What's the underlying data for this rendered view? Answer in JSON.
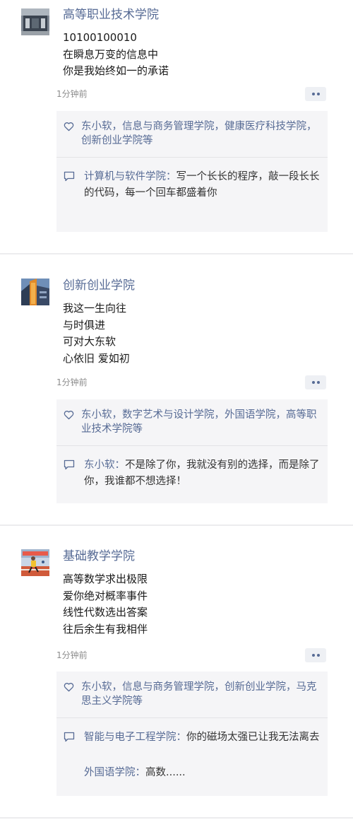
{
  "posts": [
    {
      "author": "高等职业技术学院",
      "lines": [
        "10100100010",
        "在瞬息万变的信息中",
        "你是我始终如一的承诺"
      ],
      "time": "1分钟前",
      "likes": "东小软，信息与商务管理学院，健康医疗科技学院，创新创业学院等",
      "comments": [
        {
          "name": "计算机与软件学院",
          "sep": "：",
          "text": "写一个长长的程序，敲一段长长的代码，每一个回车都盛着你"
        }
      ]
    },
    {
      "author": "创新创业学院",
      "lines": [
        "我这一生向往",
        "与时俱进",
        "可对大东软",
        "心依旧 爱如初"
      ],
      "time": "1分钟前",
      "likes": "东小软，数字艺术与设计学院，外国语学院，高等职业技术学院等",
      "comments": [
        {
          "name": "东小软",
          "sep": "：",
          "text": "不是除了你，我就没有别的选择，而是除了你，我谁都不想选择！"
        }
      ]
    },
    {
      "author": "基础教学学院",
      "lines": [
        "高等数学求出极限",
        "爱你绝对概率事件",
        "线性代数选出答案",
        "往后余生有我相伴"
      ],
      "time": "1分钟前",
      "likes": "东小软，信息与商务管理学院，创新创业学院，马克思主义学院等",
      "comments": [
        {
          "name": "智能与电子工程学院",
          "sep": "：",
          "text": "你的磁场太强已让我无法离去"
        },
        {
          "name": "外国语学院",
          "sep": "：",
          "text": "高数......"
        }
      ]
    }
  ],
  "icons": {
    "heart": "heart-icon",
    "comment": "comment-icon",
    "more": "more-dots-icon"
  },
  "colors": {
    "name_blue": "#576b95",
    "panel_bg": "#f5f5f7",
    "button_bg": "#eef0f4",
    "time_gray": "#8c8c8c"
  }
}
